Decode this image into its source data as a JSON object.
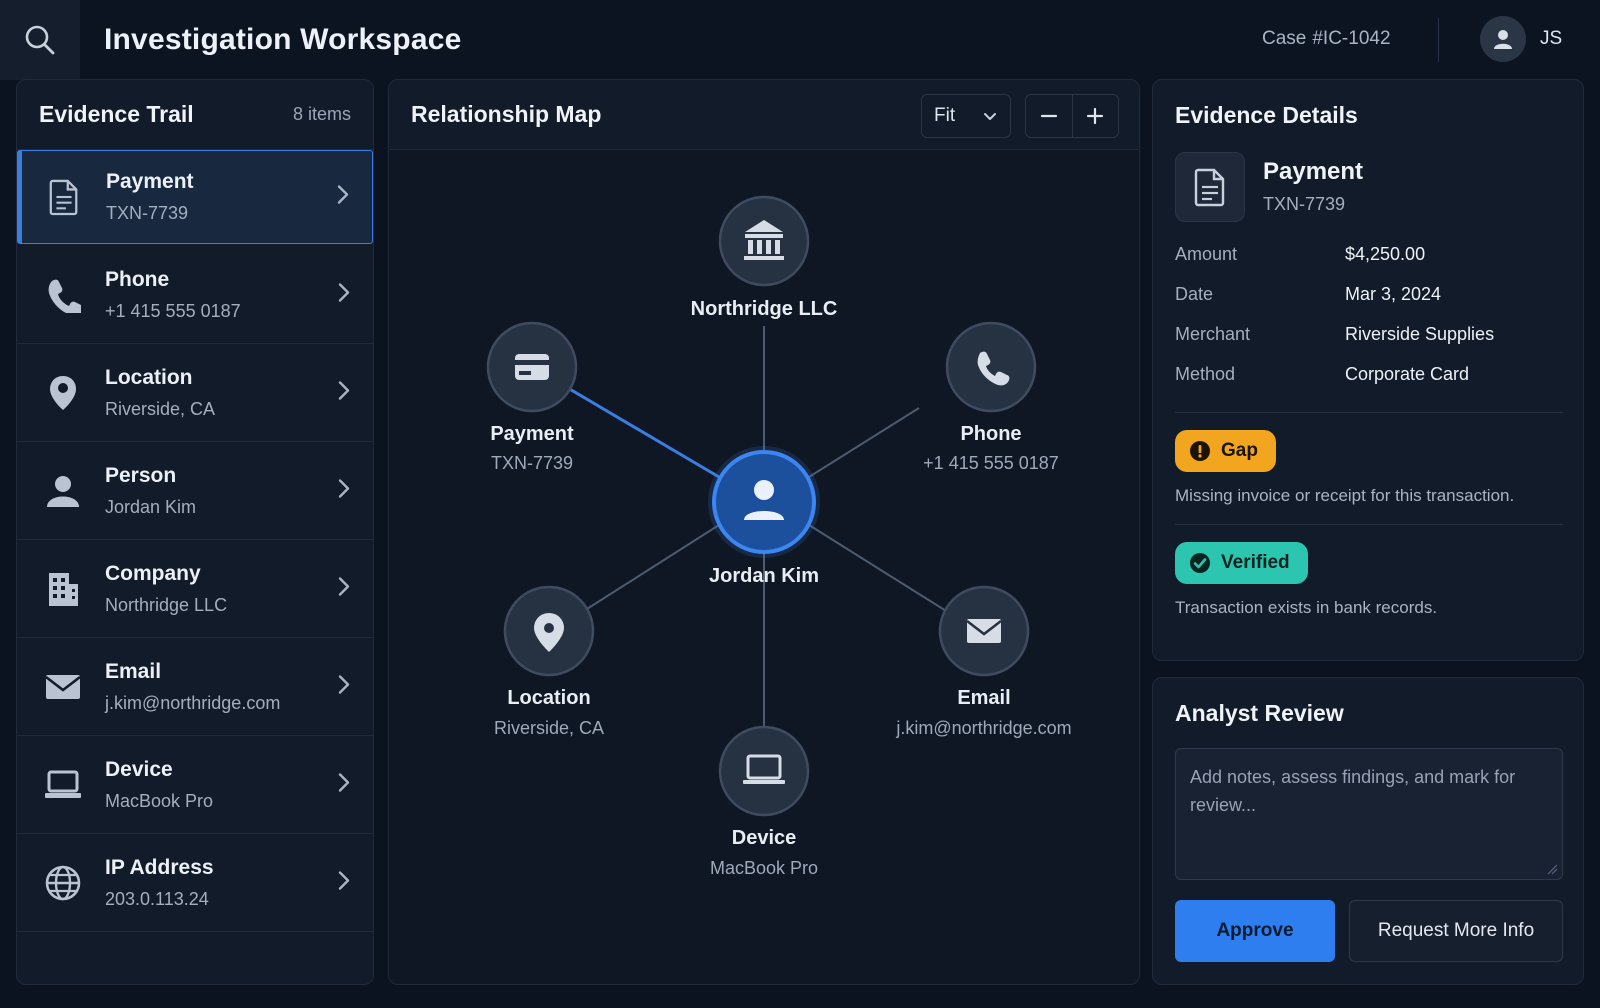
{
  "header": {
    "title": "Investigation Workspace",
    "case_label": "Case",
    "case_id": "#IC-1042",
    "user_initials": "JS"
  },
  "evidence_trail": {
    "title": "Evidence Trail",
    "count": "8 items",
    "items": [
      {
        "icon": "document-icon",
        "title": "Payment",
        "sub": "TXN-7739",
        "active": true
      },
      {
        "icon": "phone-icon",
        "title": "Phone",
        "sub": "+1 415 555 0187"
      },
      {
        "icon": "location-pin-icon",
        "title": "Location",
        "sub": "Riverside, CA"
      },
      {
        "icon": "person-icon",
        "title": "Person",
        "sub": "Jordan Kim"
      },
      {
        "icon": "building-icon",
        "title": "Company",
        "sub": "Northridge LLC"
      },
      {
        "icon": "envelope-icon",
        "title": "Email",
        "sub": "j.kim@northridge.com"
      },
      {
        "icon": "laptop-icon",
        "title": "Device",
        "sub": "MacBook Pro"
      },
      {
        "icon": "globe-icon",
        "title": "IP Address",
        "sub": "203.0.113.24"
      }
    ]
  },
  "map": {
    "title": "Relationship Map",
    "fit_label": "Fit",
    "center": {
      "label": "Jordan Kim",
      "icon": "person-icon"
    },
    "nodes": [
      {
        "label": "Northridge LLC",
        "sub": "",
        "icon": "bank-icon",
        "highlighted": false
      },
      {
        "label": "Payment",
        "sub": "TXN-7739",
        "icon": "credit-card-icon",
        "highlighted": true
      },
      {
        "label": "Phone",
        "sub": "+1 415 555 0187",
        "icon": "phone-icon",
        "highlighted": false
      },
      {
        "label": "Location",
        "sub": "Riverside, CA",
        "icon": "location-pin-icon",
        "highlighted": false
      },
      {
        "label": "Email",
        "sub": "j.kim@northridge.com",
        "icon": "envelope-icon",
        "highlighted": false
      },
      {
        "label": "Device",
        "sub": "MacBook Pro",
        "icon": "laptop-icon",
        "highlighted": false
      }
    ]
  },
  "details": {
    "title": "Evidence Details",
    "item_title": "Payment",
    "item_sub": "TXN-7739",
    "fields": [
      {
        "key": "Amount",
        "value": "$4,250.00"
      },
      {
        "key": "Date",
        "value": "Mar 3, 2024"
      },
      {
        "key": "Merchant",
        "value": "Riverside Supplies"
      },
      {
        "key": "Method",
        "value": "Corporate Card"
      }
    ],
    "gap_badge": "Gap",
    "gap_note": "Missing invoice or receipt for this transaction.",
    "verified_badge": "Verified",
    "verified_note": "Transaction exists in bank records."
  },
  "review": {
    "title": "Analyst Review",
    "notes_placeholder": "Add notes, assess findings, and mark for review...",
    "approve_label": "Approve",
    "request_label": "Request More Info"
  },
  "colors": {
    "accent": "#2f7ef0",
    "gap": "#f2a51e",
    "verified": "#2cc6b0",
    "background": "#0c1320"
  }
}
